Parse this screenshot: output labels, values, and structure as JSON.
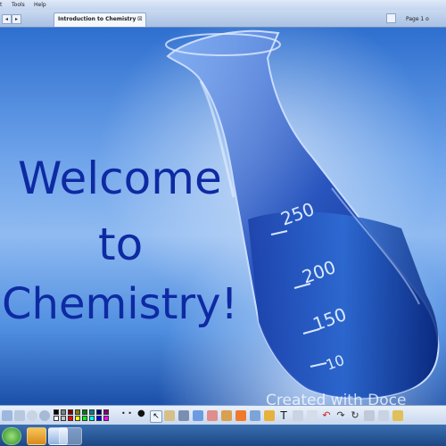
{
  "menubar": {
    "items": [
      "t",
      "Tools",
      "Help"
    ]
  },
  "tabs": [
    {
      "label": "Introduction to Chemistry",
      "close": "⊠"
    }
  ],
  "page_indicator": "Page 1 o",
  "slide": {
    "title_lines": [
      "Welcome",
      "to",
      "Chemistry!"
    ],
    "flask_markings": [
      "250",
      "200",
      "150",
      "10"
    ],
    "watermark": "Created with Doce"
  },
  "toolbar": {
    "colors": [
      "#000000",
      "#7f7f7f",
      "#7f0000",
      "#7f7f00",
      "#007f00",
      "#007f7f",
      "#00007f",
      "#7f007f",
      "#ffffff",
      "#c3c3c3",
      "#ff0000",
      "#ffff00",
      "#00ff00",
      "#00ffff",
      "#0000ff",
      "#ff00ff"
    ],
    "tool_icons": [
      "pointer-icon",
      "brush-icon",
      "pen-icon",
      "highlighter-icon",
      "eraser-icon",
      "shapes-icon",
      "line-icon",
      "text-icon",
      "undo-icon",
      "redo-icon",
      "delete-icon"
    ]
  },
  "taskbar": {
    "items": [
      "start-icon",
      "explorer-icon",
      "media-icon",
      "app-icon"
    ]
  }
}
